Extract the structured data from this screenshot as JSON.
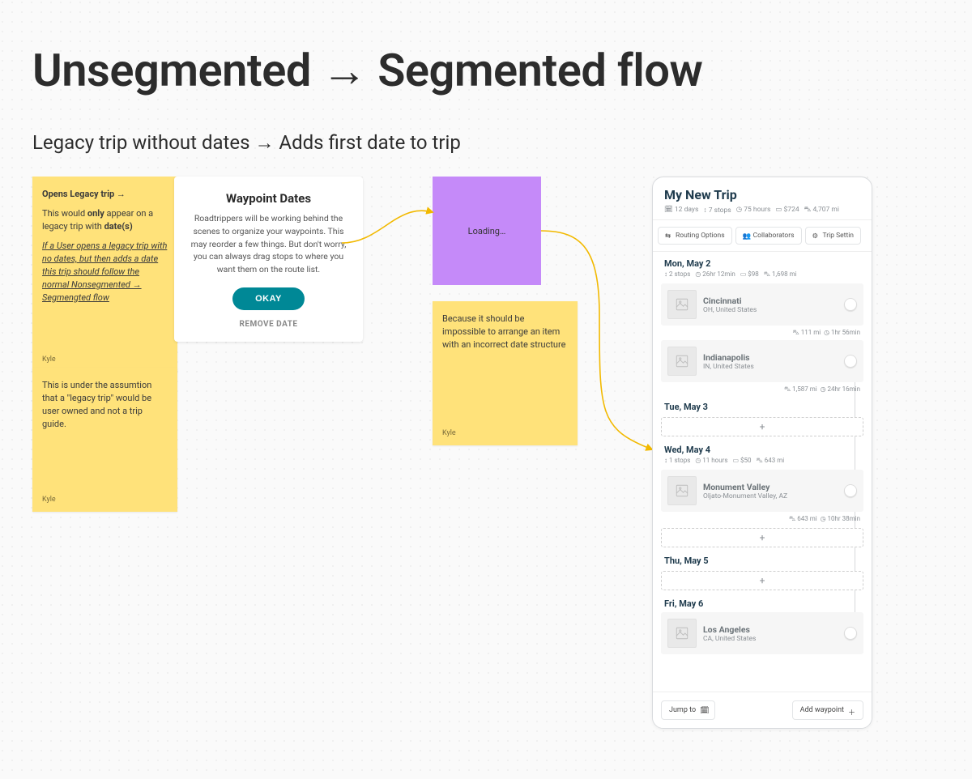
{
  "title": "Unsegmented → Segmented flow",
  "subtitle": "Legacy trip without dates → Adds first date to trip",
  "notes": {
    "n1": {
      "headline": "Opens Legacy trip →",
      "line1_a": "This would ",
      "line1_b": "only",
      "line1_c": " appear on a legacy trip with ",
      "line1_d": "date(s)",
      "para2": "If a User opens a legacy trip with no dates, but then adds a date this trip should follow the normal Nonsegmented → Segmengted flow",
      "author": "Kyle"
    },
    "n2": {
      "body": "This is under the assumtion that a \"legacy trip\" would be user owned and not a trip guide.",
      "author": "Kyle"
    },
    "n4": {
      "body": "Because it should be impossible to arrange an item with an incorrect date structure",
      "author": "Kyle"
    }
  },
  "modal": {
    "title": "Waypoint Dates",
    "body": "Roadtrippers will be working behind the scenes to organize your waypoints. This may reorder a few things. But don't worry, you can always drag stops to where you want them on the route list.",
    "ok": "OKAY",
    "remove": "REMOVE DATE"
  },
  "loading": "Loading…",
  "trip": {
    "title": "My New Trip",
    "meta": {
      "days": "12 days",
      "stops": "7 stops",
      "hours": "75 hours",
      "cost": "$724",
      "dist": "4,707 mi"
    },
    "toolbar": {
      "routing": "Routing Options",
      "collab": "Collaborators",
      "settings": "Trip Settin"
    },
    "days": [
      {
        "label": "Mon, May 2",
        "sub": {
          "stops": "2 stops",
          "time": "26hr 12min",
          "cost": "$98",
          "dist": "1,698 mi"
        },
        "items": [
          {
            "name": "Cincinnati",
            "sub": "OH, United States"
          },
          {
            "leg": {
              "dist": "111 mi",
              "time": "1hr 56min"
            }
          },
          {
            "name": "Indianapolis",
            "sub": "IN, United States"
          },
          {
            "leg": {
              "dist": "1,587 mi",
              "time": "24hr 16min"
            }
          }
        ]
      },
      {
        "label": "Tue, May 3",
        "slot": true
      },
      {
        "label": "Wed, May 4",
        "sub": {
          "stops": "1 stops",
          "time": "11 hours",
          "cost": "$50",
          "dist": "643 mi"
        },
        "items": [
          {
            "name": "Monument Valley",
            "sub": "Oljato-Monument Valley, AZ"
          },
          {
            "leg": {
              "dist": "643 mi",
              "time": "10hr 38min"
            }
          }
        ],
        "slot_after": true
      },
      {
        "label": "Thu, May 5",
        "slot": true
      },
      {
        "label": "Fri, May 6",
        "items": [
          {
            "name": "Los Angeles",
            "sub": "CA, United States"
          }
        ]
      }
    ],
    "footer": {
      "jump": "Jump to",
      "add": "Add waypoint"
    }
  },
  "icons": {
    "calendar": "calendar-icon",
    "stops": "flag-icon",
    "clock": "clock-icon",
    "money": "money-icon",
    "car": "car-icon",
    "route": "route-icon",
    "people": "people-icon",
    "gear": "gear-icon",
    "plus": "plus-icon"
  }
}
